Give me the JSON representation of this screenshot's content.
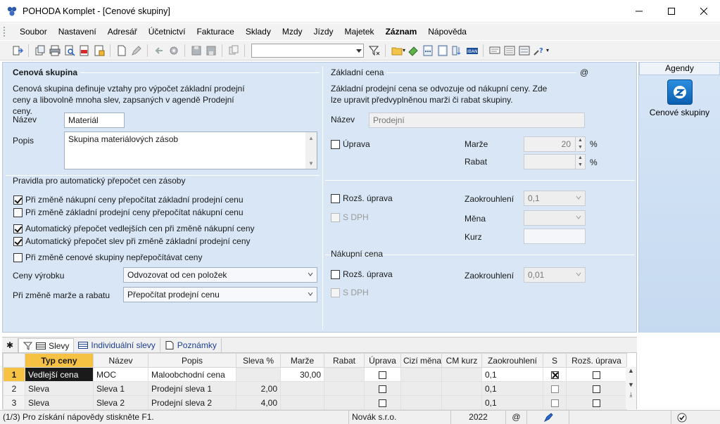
{
  "window": {
    "title": "POHODA Komplet - [Cenové skupiny]"
  },
  "menu": [
    "Soubor",
    "Nastavení",
    "Adresář",
    "Účetnictví",
    "Fakturace",
    "Sklady",
    "Mzdy",
    "Jízdy",
    "Majetek",
    "Záznam",
    "Nápověda"
  ],
  "cenova_skupina": {
    "title": "Cenová skupina",
    "description": "Cenová skupina definuje vztahy pro výpočet základní prodejní ceny a libovolně mnoha slev, zapsaných v agendě Prodejní ceny.",
    "nazev_label": "Název",
    "nazev_value": "Materiál",
    "popis_label": "Popis",
    "popis_value": "Skupina materiálových zásob"
  },
  "pravidla": {
    "title": "Pravidla pro automatický přepočet cen zásoby",
    "checks": [
      {
        "label": "Při změně nákupní ceny přepočítat základní prodejní cenu",
        "checked": true
      },
      {
        "label": "Při změně základní prodejní ceny přepočítat nákupní cenu",
        "checked": false
      },
      {
        "label": "Automatický přepočet vedlejších cen při změně nákupní ceny",
        "checked": true
      },
      {
        "label": "Automatický přepočet slev při změně základní prodejní ceny",
        "checked": true
      },
      {
        "label": "Při změně cenové skupiny nepřepočítávat ceny",
        "checked": false
      }
    ],
    "ceny_vyrobku_label": "Ceny výrobku",
    "ceny_vyrobku_value": "Odvozovat od cen položek",
    "zmena_marze_label": "Při změně marže a rabatu",
    "zmena_marze_value": "Přepočítat prodejní cenu"
  },
  "zakladni_cena": {
    "title": "Základní cena",
    "at": "@",
    "description": "Základní prodejní cena se odvozuje od nákupní ceny. Zde lze upravit předvyplněnou marži či rabat skupiny.",
    "nazev_label": "Název",
    "nazev_value": "Prodejní",
    "uprava_label": "Úprava",
    "marze_label": "Marže",
    "marze_value": "20",
    "rabat_label": "Rabat",
    "pct": "%",
    "roz_uprava_label": "Rozš. úprava",
    "s_dph_label": "S DPH",
    "zaokrouhleni_label": "Zaokrouhlení",
    "zaokrouhleni_value": "0,1",
    "mena_label": "Měna",
    "kurz_label": "Kurz"
  },
  "nakupni_cena": {
    "title": "Nákupní cena",
    "roz_uprava_label": "Rozš. úprava",
    "s_dph_label": "S DPH",
    "zaokrouhleni_label": "Zaokrouhlení",
    "zaokrouhleni_value": "0,01"
  },
  "agendy": {
    "title": "Agendy",
    "item": "Cenové skupiny"
  },
  "tabs": {
    "star": "✱",
    "slevy": "Slevy",
    "individualni": "Individuální slevy",
    "poznamky": "Poznámky"
  },
  "grid": {
    "columns": [
      "Typ ceny",
      "Název",
      "Popis",
      "Sleva %",
      "Marže",
      "Rabat",
      "Úprava",
      "Cizí měna",
      "CM kurz",
      "Zaokrouhlení",
      "S",
      "Rozš. úprava"
    ],
    "rows": [
      {
        "num": "1",
        "typ": "Vedlejší cena",
        "nazev": "MOC",
        "popis": "Maloobchodní cena",
        "sleva": "",
        "marze": "30,00",
        "rabat": "",
        "zaokrouhleni": "0,1"
      },
      {
        "num": "2",
        "typ": "Sleva",
        "nazev": "Sleva 1",
        "popis": "Prodejní sleva 1",
        "sleva": "2,00",
        "marze": "",
        "rabat": "",
        "zaokrouhleni": "0,1"
      },
      {
        "num": "3",
        "typ": "Sleva",
        "nazev": "Sleva 2",
        "popis": "Prodejní sleva 2",
        "sleva": "4,00",
        "marze": "",
        "rabat": "",
        "zaokrouhleni": "0,1"
      }
    ]
  },
  "status": {
    "help": "(1/3) Pro získání nápovědy stiskněte F1.",
    "company": "Novák s.r.o.",
    "year": "2022",
    "at": "@"
  }
}
